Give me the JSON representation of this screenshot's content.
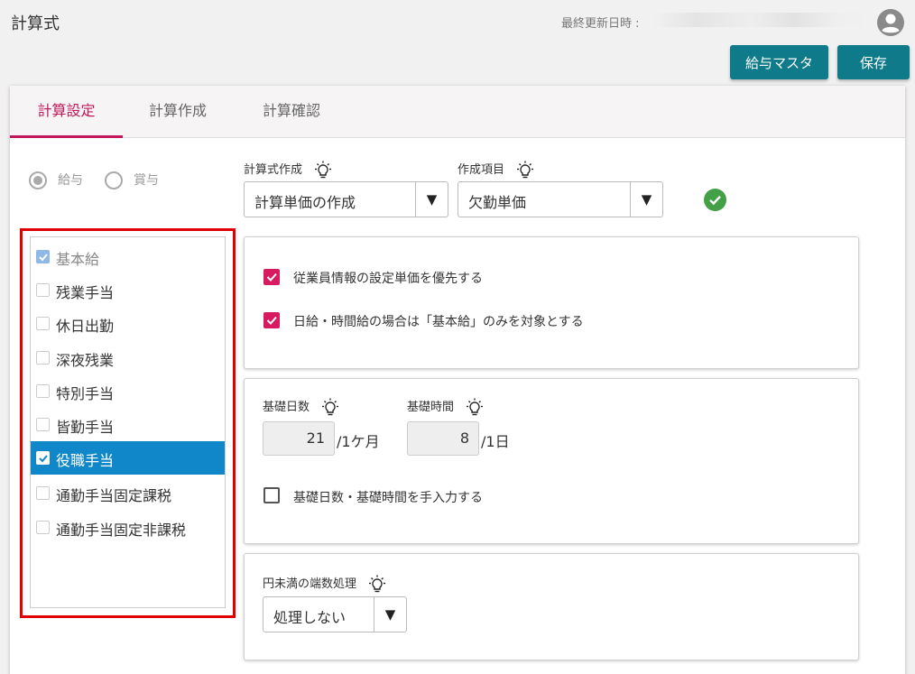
{
  "header": {
    "title": "計算式",
    "last_updated_label": "最終更新日時 :",
    "buttons": {
      "salary_master": "給与マスタ",
      "save": "保存"
    },
    "icons": [
      "avatar-icon"
    ]
  },
  "tabs": [
    {
      "label": "計算設定",
      "active": true
    },
    {
      "label": "計算作成",
      "active": false
    },
    {
      "label": "計算確認",
      "active": false
    }
  ],
  "pay_type": {
    "options": [
      {
        "label": "給与",
        "selected": true
      },
      {
        "label": "賞与",
        "selected": false
      }
    ]
  },
  "formula": {
    "label": "計算式作成",
    "selected": "計算単価の作成",
    "item_label": "作成項目",
    "item_selected": "欠勤単価",
    "status": "ok"
  },
  "allowance_list": [
    {
      "label": "基本給",
      "checked": true,
      "disabled": true
    },
    {
      "label": "残業手当",
      "checked": false
    },
    {
      "label": "休日出勤",
      "checked": false
    },
    {
      "label": "深夜残業",
      "checked": false
    },
    {
      "label": "特別手当",
      "checked": false
    },
    {
      "label": "皆勤手当",
      "checked": false
    },
    {
      "label": "役職手当",
      "checked": true,
      "selected": true
    },
    {
      "label": "通勤手当固定課税",
      "checked": false
    },
    {
      "label": "通勤手当固定非課税",
      "checked": false
    }
  ],
  "options": {
    "prefer_employee_unit": {
      "label": "従業員情報の設定単価を優先する",
      "checked": true
    },
    "daily_hourly_base_only": {
      "label": "日給・時間給の場合は「基本給」のみを対象とする",
      "checked": true
    }
  },
  "basis": {
    "days_label": "基礎日数",
    "days_value": "21",
    "days_unit": "/1ケ月",
    "hours_label": "基礎時間",
    "hours_value": "8",
    "hours_unit": "/1日",
    "manual_label": "基礎日数・基礎時間を手入力する",
    "manual_checked": false
  },
  "rounding": {
    "label": "円未満の端数処理",
    "selected": "処理しない"
  },
  "colors": {
    "primary": "#0e7a8a",
    "accent": "#c2185b",
    "selected_row": "#0f87c8",
    "check_pink": "#d81b60",
    "ok_green": "#43a047",
    "highlight_red": "#e00000"
  }
}
